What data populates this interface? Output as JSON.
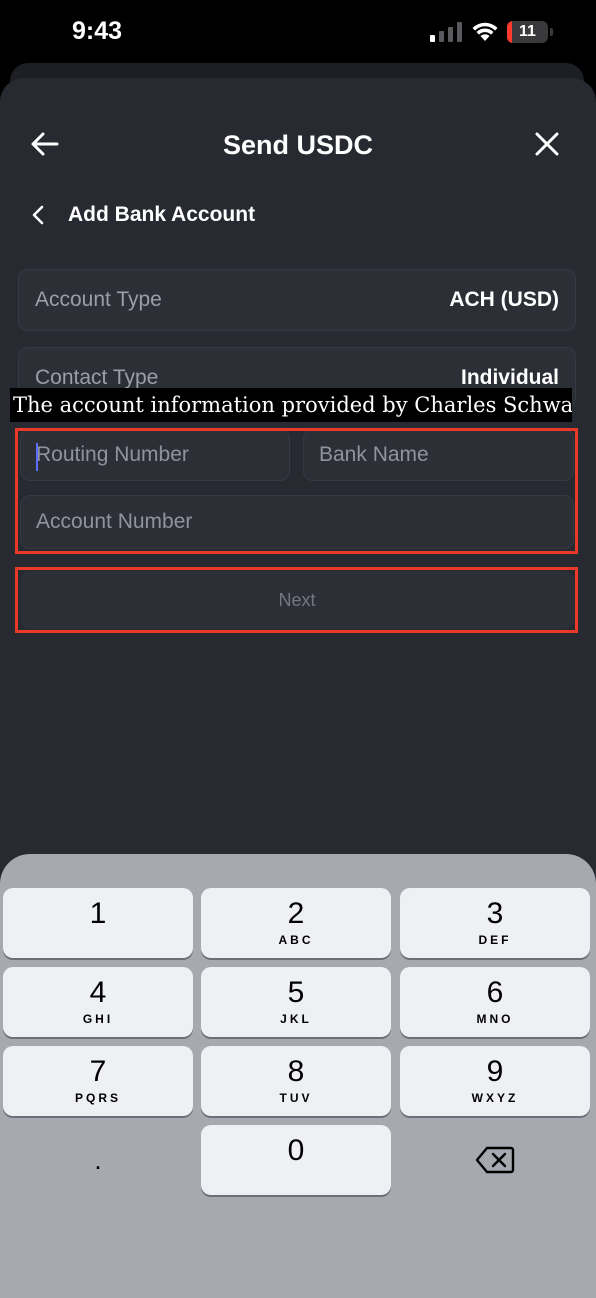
{
  "status_bar": {
    "time": "9:43",
    "battery": "11",
    "battery_percent": 11
  },
  "header": {
    "title": "Send USDC",
    "back_icon": "arrow-left-icon",
    "close_icon": "close-icon"
  },
  "subheader": {
    "title": "Add Bank Account",
    "back_icon": "chevron-left-icon"
  },
  "account_type": {
    "label": "Account Type",
    "value": "ACH (USD)"
  },
  "contact_type": {
    "label": "Contact Type",
    "value": "Individual"
  },
  "caption": "The account information provided by Charles Schwab",
  "routing_number": {
    "placeholder": "Routing Number",
    "value": ""
  },
  "bank_name": {
    "placeholder": "Bank Name",
    "value": ""
  },
  "account_number": {
    "placeholder": "Account Number",
    "value": ""
  },
  "next_button": {
    "label": "Next"
  },
  "colors": {
    "highlight": "#e8392b",
    "background": "#272a31",
    "caret": "#5b6cff"
  },
  "keyboard": {
    "keys": [
      {
        "num": "1",
        "letters": ""
      },
      {
        "num": "2",
        "letters": "ABC"
      },
      {
        "num": "3",
        "letters": "DEF"
      },
      {
        "num": "4",
        "letters": "GHI"
      },
      {
        "num": "5",
        "letters": "JKL"
      },
      {
        "num": "6",
        "letters": "MNO"
      },
      {
        "num": "7",
        "letters": "PQRS"
      },
      {
        "num": "8",
        "letters": "TUV"
      },
      {
        "num": "9",
        "letters": "WXYZ"
      },
      {
        "num": "0",
        "letters": ""
      }
    ],
    "dot": ".",
    "delete_icon": "backspace-icon"
  }
}
